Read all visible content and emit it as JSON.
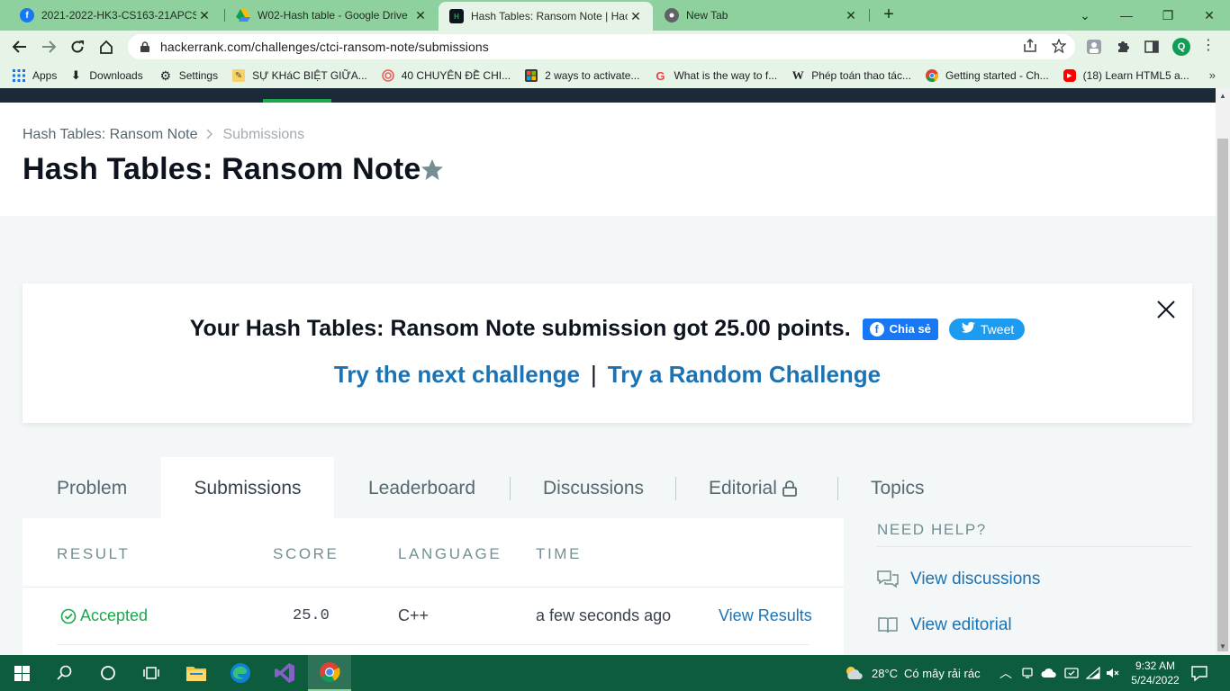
{
  "browser": {
    "tabs": [
      {
        "title": "2021-2022-HK3-CS163-21APCS |",
        "favicon": "facebook-icon",
        "color": "#1877f2"
      },
      {
        "title": "W02-Hash table - Google Drive",
        "favicon": "google-drive-icon",
        "color": "#fbbc04"
      },
      {
        "title": "Hash Tables: Ransom Note | Hack",
        "favicon": "hackerrank-icon",
        "color": "#0e141e"
      },
      {
        "title": "New Tab",
        "favicon": "chrome-icon",
        "color": "#5f6368"
      }
    ],
    "url": "hackerrank.com/challenges/ctci-ransom-note/submissions",
    "profile_initial": "Q",
    "bookmarks": [
      {
        "label": "Apps",
        "icon": "apps-grid-icon"
      },
      {
        "label": "Downloads",
        "icon": "download-icon"
      },
      {
        "label": "Settings",
        "icon": "gear-icon"
      },
      {
        "label": "SỰ KHáC BIỆT GIỮA...",
        "icon": "note-icon"
      },
      {
        "label": "40 CHUYÊN ĐỀ CHI...",
        "icon": "target-icon"
      },
      {
        "label": "2 ways to activate...",
        "icon": "windows-icon"
      },
      {
        "label": "What is the way to f...",
        "icon": "grammarly-icon"
      },
      {
        "label": "Phép toán thao tác...",
        "icon": "wikipedia-icon"
      },
      {
        "label": "Getting started - Ch...",
        "icon": "chrome-icon"
      },
      {
        "label": "(18) Learn HTML5 a...",
        "icon": "youtube-icon"
      }
    ]
  },
  "page": {
    "breadcrumb": [
      "Hash Tables: Ransom Note",
      "Submissions"
    ],
    "title": "Hash Tables: Ransom Note",
    "banner": {
      "message": "Your Hash Tables: Ransom Note submission got 25.00 points.",
      "share_label": "Chia sẻ",
      "tweet_label": "Tweet",
      "next_challenge": "Try the next challenge",
      "separator": "|",
      "random_challenge": "Try a Random Challenge"
    },
    "tabs": [
      "Problem",
      "Submissions",
      "Leaderboard",
      "Discussions",
      "Editorial",
      "Topics"
    ],
    "active_tab": "Submissions",
    "table": {
      "headers": [
        "RESULT",
        "SCORE",
        "LANGUAGE",
        "TIME"
      ],
      "rows": [
        {
          "status": "Accepted",
          "score": "25.0",
          "language": "C++",
          "time": "a few seconds ago",
          "action": "View Results"
        }
      ]
    },
    "help": {
      "title": "NEED HELP?",
      "items": [
        "View discussions",
        "View editorial"
      ]
    }
  },
  "taskbar": {
    "weather": "28°C",
    "weather_text": "Có mây rải rác",
    "time": "9:32 AM",
    "date": "5/24/2022"
  },
  "colors": {
    "accent_green": "#1ba94c",
    "link_blue": "#1a73b5",
    "chrome_frame": "#8fd19e",
    "taskbar": "#0c5c3d"
  }
}
